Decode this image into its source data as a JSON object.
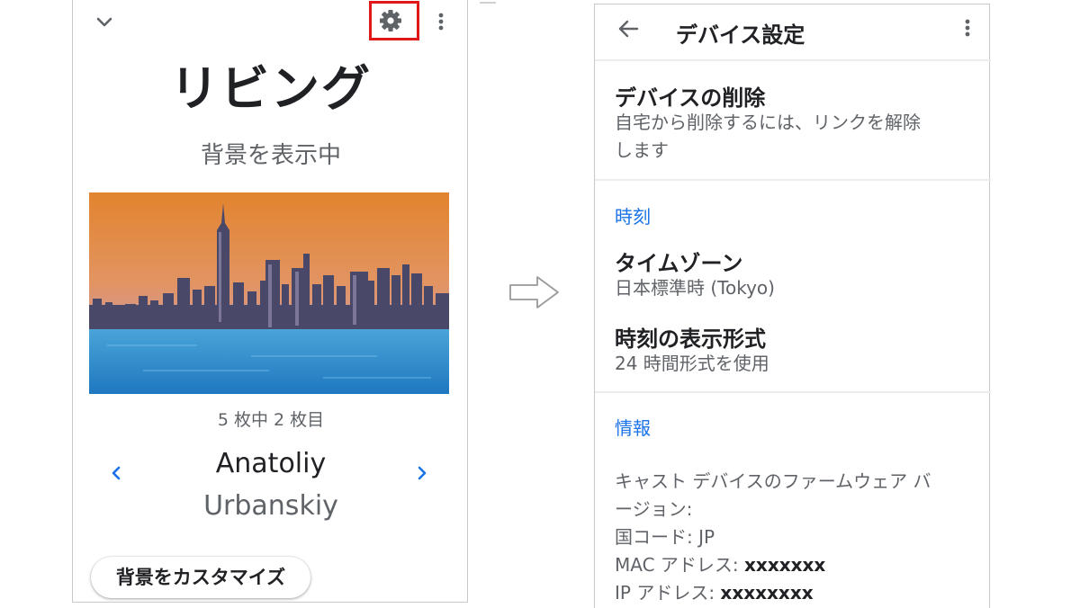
{
  "left_panel": {
    "title": "リビング",
    "subtitle": "背景を表示中",
    "counter": "5 枚中 2 枚目",
    "artist_first": "Anatoliy",
    "artist_last": "Urbanskiy",
    "customize_label": "背景をカスタマイズ",
    "icons": [
      "chevron-down-icon",
      "gear-icon",
      "more-vert-icon",
      "chevron-left-icon",
      "chevron-right-icon"
    ],
    "highlight_color": "#e01818"
  },
  "right_panel": {
    "title": "デバイス設定",
    "remove": {
      "title": "デバイスの削除",
      "desc_line1": "自宅から削除するには、リンクを解除",
      "desc_line2": "します"
    },
    "time_section": {
      "header": "時刻",
      "timezone_title": "タイムゾーン",
      "timezone_value": "日本標準時 (Tokyo)",
      "format_title": "時刻の表示形式",
      "format_value": "24 時間形式を使用"
    },
    "info_section": {
      "header": "情報",
      "firmware_line1": "キャスト デバイスのファームウェア バ",
      "firmware_line2": "ージョン:",
      "country_label": "国コード:",
      "country_value": "JP",
      "mac_label": "MAC アドレス:",
      "mac_value": "xxxxxxx",
      "ip_label": "IP アドレス:",
      "ip_value": "xxxxxxxx"
    },
    "accent_color": "#1a73e8"
  }
}
